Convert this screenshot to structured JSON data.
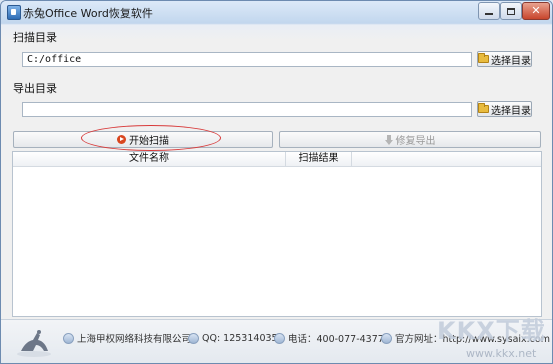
{
  "window": {
    "title": "赤兔Office Word恢复软件"
  },
  "scan_dir": {
    "label": "扫描目录",
    "value": "C:/office",
    "button_label": "选择目录"
  },
  "export_dir": {
    "label": "导出目录",
    "value": "",
    "button_label": "选择目录"
  },
  "actions": {
    "start_label": "开始扫描",
    "restore_label": "修复导出"
  },
  "table": {
    "columns": [
      "文件名称",
      "扫描结果"
    ],
    "rows": []
  },
  "footer": {
    "company": "上海甲权网络科技有限公司",
    "qq": "QQ: 1253140355",
    "phone": "电话：400-077-4377",
    "website": "官方网址：http://www.sysaix.com"
  },
  "watermark": {
    "text": "KKX下载",
    "url": "www.kkx.net"
  },
  "icons": [
    "app-icon",
    "minimize-icon",
    "maximize-icon",
    "close-icon",
    "folder-icon",
    "play-icon",
    "download-arrow-icon",
    "logo-icon",
    "company-icon",
    "qq-icon",
    "phone-icon",
    "website-icon"
  ],
  "colors": {
    "accent_red": "#d83a3a",
    "start_icon": "#d9461f",
    "disabled_text": "#9a9a9a"
  }
}
